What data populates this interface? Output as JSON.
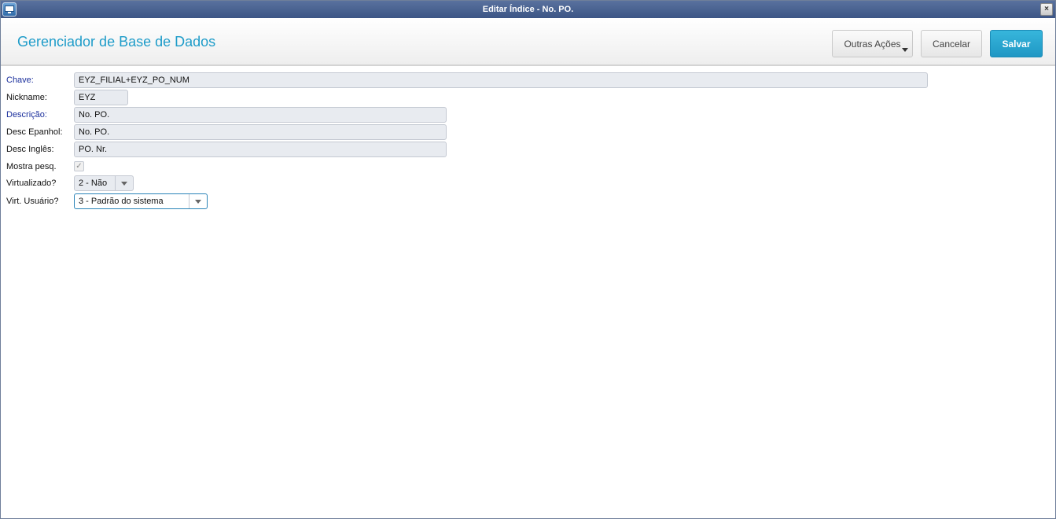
{
  "window": {
    "title": "Editar Índice - No. PO.",
    "close_label": "×"
  },
  "header": {
    "title": "Gerenciador de Base de Dados",
    "more_actions_label": "Outras Ações",
    "cancel_label": "Cancelar",
    "save_label": "Salvar"
  },
  "form": {
    "chave": {
      "label": "Chave:",
      "value": "EYZ_FILIAL+EYZ_PO_NUM"
    },
    "nickname": {
      "label": "Nickname:",
      "value": "EYZ"
    },
    "descricao": {
      "label": "Descrição:",
      "value": "No. PO."
    },
    "desc_espanhol": {
      "label": "Desc Epanhol:",
      "value": "No. PO."
    },
    "desc_ingles": {
      "label": "Desc Inglês:",
      "value": "PO. Nr."
    },
    "mostra_pesq": {
      "label": "Mostra pesq.",
      "checked": true,
      "check_glyph": "✓"
    },
    "virtualizado": {
      "label": "Virtualizado?",
      "value": "2 - Não"
    },
    "virt_usuario": {
      "label": "Virt. Usuário?",
      "value": "3 - Padrão do sistema"
    }
  },
  "colors": {
    "accent": "#1e9cc9",
    "titlebar": "#4a6392",
    "required_label": "#1b2f9c"
  }
}
